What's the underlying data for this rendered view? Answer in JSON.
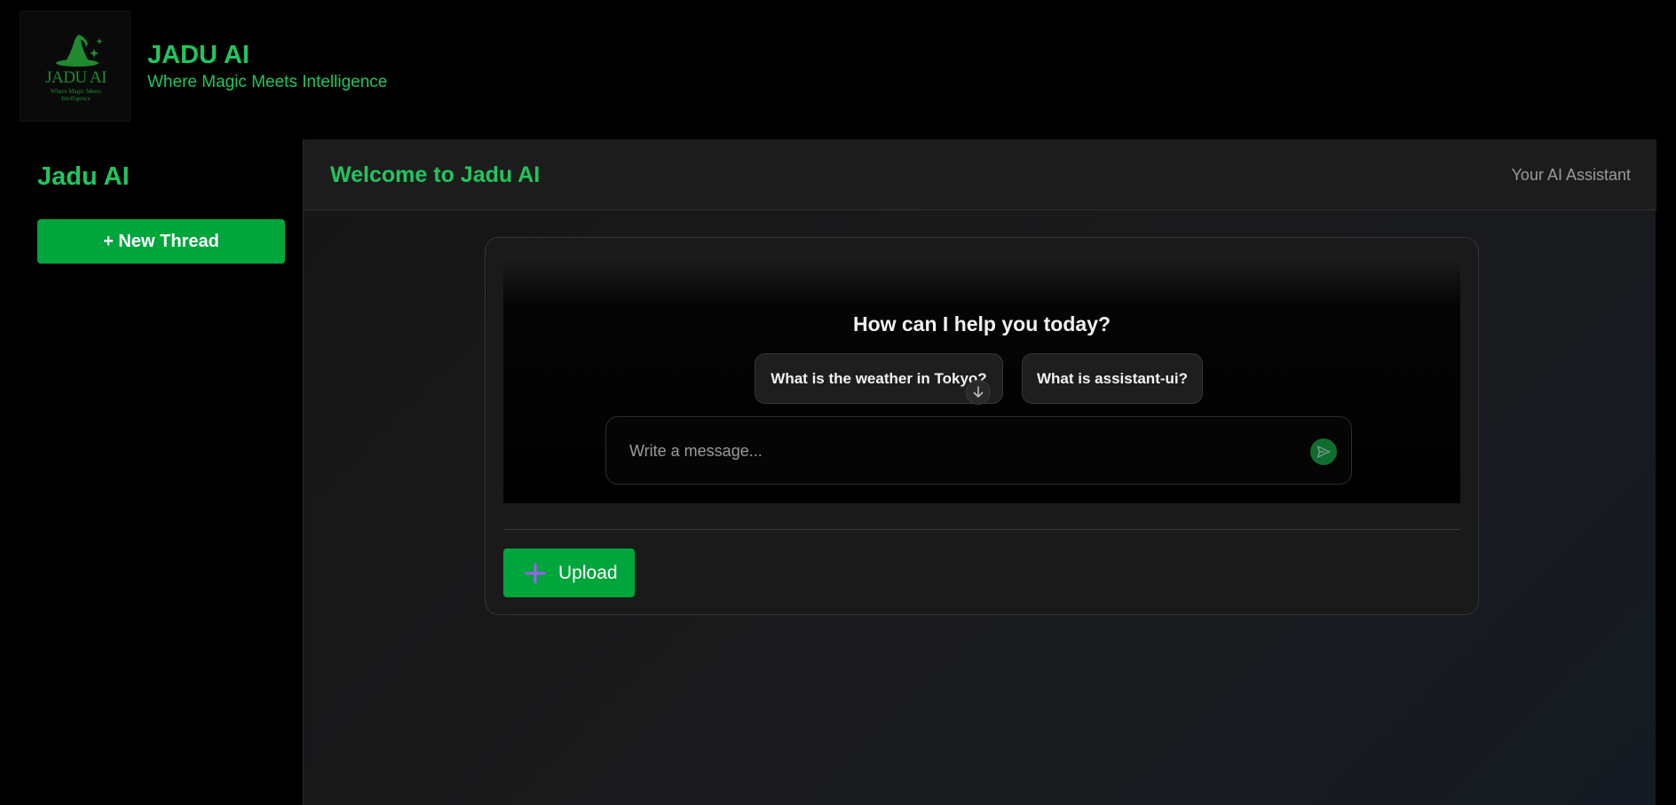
{
  "header": {
    "logo": {
      "text": "JADU AI",
      "subtext": "Where Magic Meets Intelligence",
      "icon": "wizard-hat-icon",
      "color": "#1f8a2e"
    },
    "title": "JADU AI",
    "tagline": "Where Magic Meets Intelligence"
  },
  "sidebar": {
    "title": "Jadu AI",
    "new_thread_label": "+ New Thread"
  },
  "main": {
    "title": "Welcome to Jadu AI",
    "subtitle": "Your AI Assistant",
    "chat": {
      "welcome": "How can I help you today?",
      "suggestions": [
        "What is the weather in Tokyo?",
        "What is assistant-ui?"
      ],
      "scroll_icon": "arrow-down-icon",
      "composer_placeholder": "Write a message...",
      "send_icon": "send-icon"
    },
    "upload_label": "Upload",
    "upload_icon": "plus-icon"
  },
  "colors": {
    "accent": "#21c55d",
    "button": "#00a53c",
    "upload_plus": "#a35cff"
  }
}
